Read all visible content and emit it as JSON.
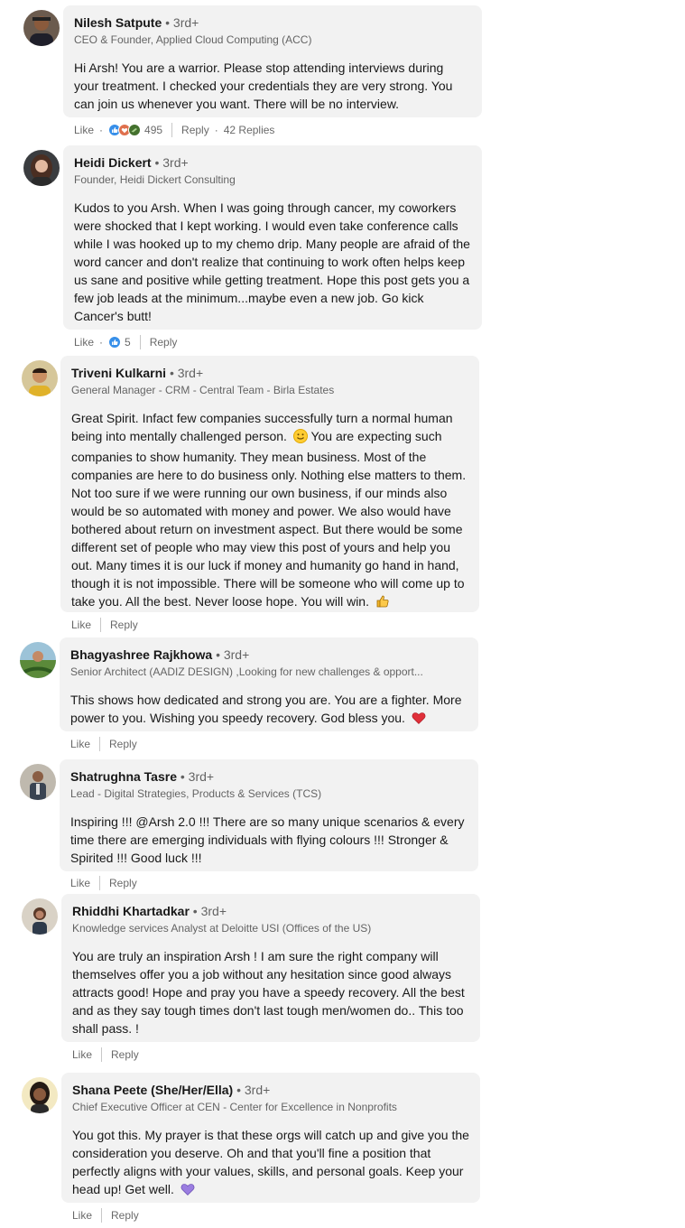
{
  "comments": [
    {
      "name": "Nilesh Satpute",
      "degree": "• 3rd+",
      "headline": "CEO & Founder, Applied Cloud Computing (ACC)",
      "body": "Hi Arsh! You are a warrior. Please stop attending interviews during your treatment. I checked your credentials they are very strong. You can join us whenever you want. There will be no interview.",
      "like_label": "Like",
      "reaction_count": "495",
      "reply_label": "Reply",
      "replies_label": "42 Replies"
    },
    {
      "name": "Heidi Dickert",
      "degree": "• 3rd+",
      "headline": "Founder, Heidi Dickert Consulting",
      "body": "Kudos to you Arsh. When I was going through cancer, my coworkers were shocked that I kept working. I would even take conference calls while I was hooked up to my chemo drip. Many people are afraid of the word cancer and don't realize that continuing to work often helps keep us sane and positive while getting treatment. Hope this post gets you a few job leads at the minimum...maybe even a new job. Go kick Cancer's butt!",
      "like_label": "Like",
      "reaction_count": "5",
      "reply_label": "Reply"
    },
    {
      "name": "Triveni Kulkarni",
      "degree": "• 3rd+",
      "headline": "General Manager - CRM - Central Team - Birla Estates",
      "body_part1": "Great Spirit. Infact few companies successfully turn a normal human being into mentally challenged person.",
      "body_part2": "You are expecting such companies to show humanity. They mean business. Most of the companies are here to do business only. Nothing else matters to them. Not too sure if we were running our own business, if our minds also would be so automated with money and power. We also would have bothered about return on investment aspect. But there would be some different set of people who may view this post of yours and help you out. Many times it is our luck if money and humanity go hand in hand, though it is not impossible. There will be someone who will come up to take you. All the best. Never loose hope. You will win.",
      "like_label": "Like",
      "reply_label": "Reply"
    },
    {
      "name": "Bhagyashree Rajkhowa",
      "degree": "• 3rd+",
      "headline": "Senior Architect (AADIZ DESIGN) ,Looking for new challenges & opport...",
      "body": "This shows how dedicated and strong you are. You are a fighter. More power to you. Wishing you speedy recovery. God bless you.",
      "like_label": "Like",
      "reply_label": "Reply"
    },
    {
      "name": "Shatrughna Tasre",
      "degree": "• 3rd+",
      "headline": "Lead - Digital Strategies, Products & Services (TCS)",
      "body": "Inspiring !!! @Arsh 2.0 !!! There are so many unique scenarios & every time there are emerging individuals with flying colours !!! Stronger & Spirited !!! Good luck !!!",
      "like_label": "Like",
      "reply_label": "Reply"
    },
    {
      "name": "Rhiddhi Khartadkar",
      "degree": "• 3rd+",
      "headline": "Knowledge services Analyst at Deloitte USI (Offices of the US)",
      "body": "You are truly an inspiration Arsh ! I am sure the right company will themselves offer you a job without any hesitation since good always attracts good! Hope and pray you have a speedy recovery. All the best and as they say tough times don't last tough men/women do.. This too shall pass. !",
      "like_label": "Like",
      "reply_label": "Reply"
    },
    {
      "name": "Shana Peete (She/Her/Ella)",
      "degree": "• 3rd+",
      "headline": "Chief Executive Officer at CEN - Center for Excellence in Nonprofits",
      "body": "You got this. My prayer is that these orgs will catch up and give you the consideration you deserve. Oh and that you'll fine a position that perfectly aligns with your values, skills, and personal goals. Keep your head up! Get well.",
      "like_label": "Like",
      "reply_label": "Reply"
    }
  ],
  "colors": {
    "bubble": "#f2f2f2",
    "like_blue": "#378fe9",
    "heart_red": "#df4b48",
    "purple_heart": "#8a6bd1"
  }
}
